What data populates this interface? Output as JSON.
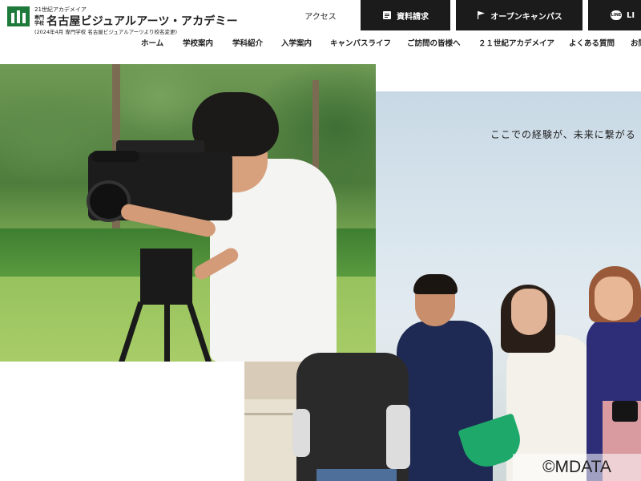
{
  "header": {
    "logo_tagline": "21世紀アカデメイア",
    "logo_small": "専門学校",
    "logo_name": "名古屋ビジュアルアーツ・アカデミー",
    "logo_note": "(2024年4月 専門学校 名古屋ビジュアルアーツより校名変更)",
    "access_label": "アクセス",
    "request_label": "資料請求",
    "opencampus_label": "オープンキャンパス",
    "line_badge": "LINE",
    "line_label": "LI"
  },
  "nav": {
    "items": [
      "ホーム",
      "学校案内",
      "学科紹介",
      "入学案内",
      "キャンパスライフ",
      "ご訪問の皆様へ",
      "２１世紀アカデメイア",
      "よくある質問",
      "お問"
    ]
  },
  "hero": {
    "tagline": "ここでの経験が、未来に繋がる",
    "copyright": "©MDATA"
  },
  "colors": {
    "brand_green": "#1e7a3a",
    "button_black": "#1b1b1b"
  }
}
